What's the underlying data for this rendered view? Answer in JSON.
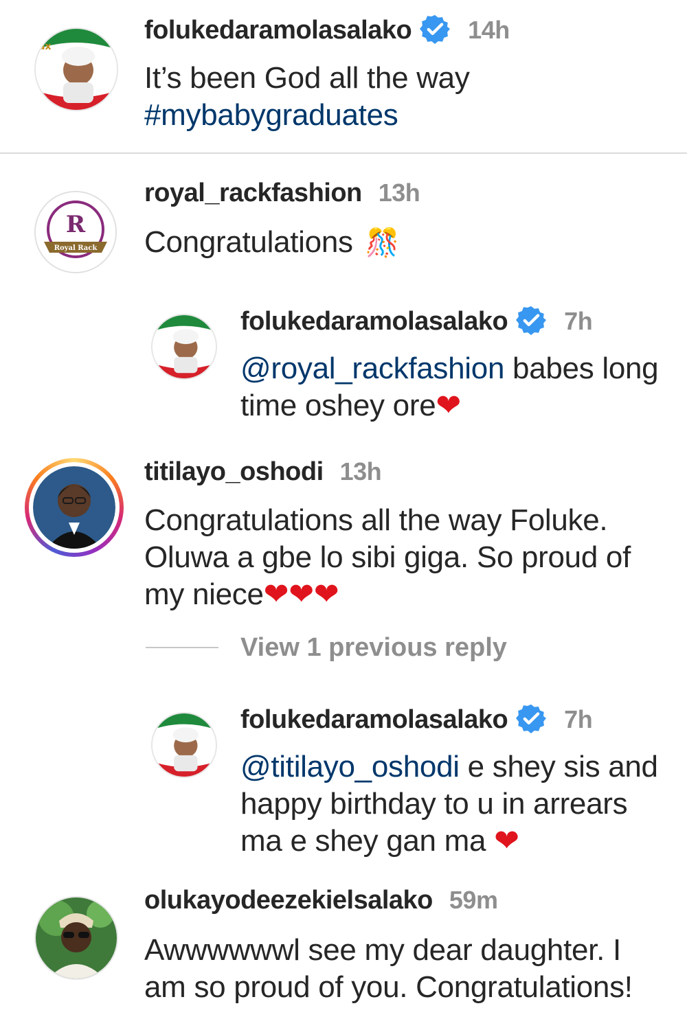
{
  "comments": [
    {
      "username": "folukedaramolasalako",
      "verified": true,
      "time": "14h",
      "text_line1": "It’s been God all the way",
      "hashtag": "#mybabygraduates"
    },
    {
      "username": "royal_rackfashion",
      "verified": false,
      "time": "13h",
      "text": "Congratulations",
      "emoji": "🎊",
      "avatar_letters": "R",
      "avatar_caption": "Royal Rack"
    },
    {
      "username": "folukedaramolasalako",
      "verified": true,
      "time": "7h",
      "mention": "@royal_rackfashion",
      "text_rest": " babes long",
      "text_line2": "time oshey ore",
      "emoji": "❤"
    },
    {
      "username": "titilayo_oshodi",
      "verified": false,
      "time": "13h",
      "text_line1": "Congratulations all the way Foluke.",
      "text_line2": "Oluwa a gbe lo sibi giga. So proud of",
      "text_line3": "my niece",
      "emoji": "❤❤❤"
    },
    {
      "view_replies": "View 1 previous reply"
    },
    {
      "username": "folukedaramolasalako",
      "verified": true,
      "time": "7h",
      "mention": "@titilayo_oshodi",
      "text_rest": " e shey sis and",
      "text_line2": "happy birthday to u in arrears",
      "text_line3": "ma e shey gan ma ",
      "emoji": "❤"
    },
    {
      "username": "olukayodeezekielsalako",
      "verified": false,
      "time": "59m",
      "text_line1": "Awwwwwwl see my dear daughter. I",
      "text_line2": "am so proud of you. Congratulations!"
    }
  ],
  "colors": {
    "verified_blue": "#3897f0",
    "link_blue": "#00376b",
    "heart_red": "#e0141c",
    "meta_gray": "#8e8e8e"
  }
}
